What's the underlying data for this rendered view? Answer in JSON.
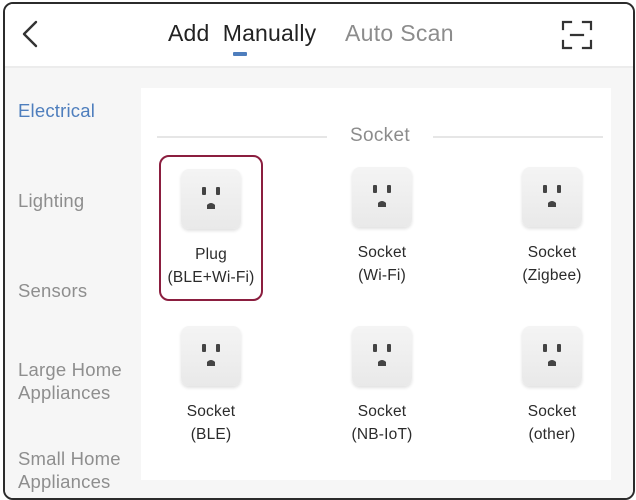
{
  "header": {
    "back_icon": "chevron-left-icon",
    "tabs": [
      {
        "label": "Add  Manually",
        "active": true
      },
      {
        "label": "Auto Scan",
        "active": false
      }
    ],
    "scan_icon": "scan-frame-icon",
    "accent_color": "#4e7ebd"
  },
  "sidebar": {
    "items": [
      {
        "label": "Electrical",
        "active": true
      },
      {
        "label": "Lighting",
        "active": false
      },
      {
        "label": "Sensors",
        "active": false
      },
      {
        "label_line1": "Large Home",
        "label_line2": "Appliances",
        "active": false
      },
      {
        "label_line1": "Small Home",
        "label_line2": "Appliances",
        "active": false
      }
    ]
  },
  "main": {
    "section_title": "Socket",
    "selected_border_color": "#8b1e3f",
    "devices": [
      {
        "line1": "Plug",
        "line2": "(BLE+Wi-Fi)",
        "icon": "power-socket-icon",
        "selected": true
      },
      {
        "line1": "Socket",
        "line2": "(Wi-Fi)",
        "icon": "power-socket-icon",
        "selected": false
      },
      {
        "line1": "Socket",
        "line2": "(Zigbee)",
        "icon": "power-socket-icon",
        "selected": false
      },
      {
        "line1": "Socket",
        "line2": "(BLE)",
        "icon": "power-socket-icon",
        "selected": false
      },
      {
        "line1": "Socket",
        "line2": "(NB-IoT)",
        "icon": "power-socket-icon",
        "selected": false
      },
      {
        "line1": "Socket",
        "line2": "(other)",
        "icon": "power-socket-icon",
        "selected": false
      }
    ]
  }
}
